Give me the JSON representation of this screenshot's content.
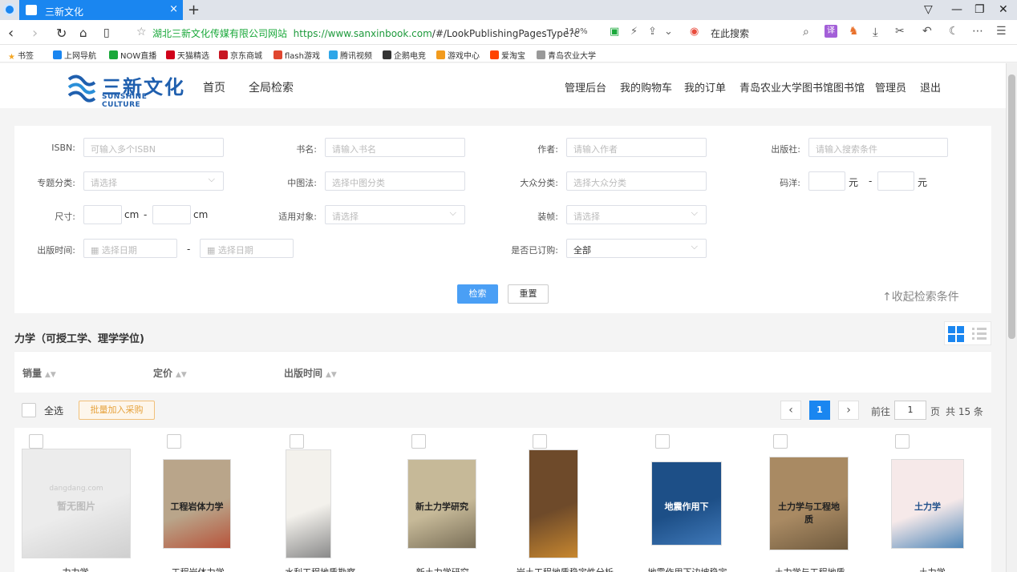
{
  "browser": {
    "tab_title": "三新文化",
    "tab_close": "×",
    "new_tab": "+",
    "site_name": "湖北三新文化传媒有限公司网站",
    "url_domain": "https://www.sanxinbook.com",
    "url_path": "/#/LookPublishingPagesType?c",
    "zoom": "110%",
    "search_label": "在此搜索",
    "bookmarks": [
      {
        "label": "书签",
        "color": "#f5a623"
      },
      {
        "label": "上网导航",
        "color": "#1a86f0"
      },
      {
        "label": "NOW直播",
        "color": "#1aa83a"
      },
      {
        "label": "天猫精选",
        "color": "#d0021b"
      },
      {
        "label": "京东商城",
        "color": "#c81623"
      },
      {
        "label": "flash游戏",
        "color": "#e0462f"
      },
      {
        "label": "腾讯视频",
        "color": "#2fa6e8"
      },
      {
        "label": "企鹅电竞",
        "color": "#333333"
      },
      {
        "label": "游戏中心",
        "color": "#f29b1d"
      },
      {
        "label": "爱淘宝",
        "color": "#ff4400"
      },
      {
        "label": "青岛农业大学",
        "color": "#999999"
      }
    ]
  },
  "header": {
    "logo_cn": "三新文化",
    "logo_en": "SUNSHINE CULTURE",
    "nav_home": "首页",
    "nav_search": "全局检索",
    "right_nav": [
      "管理后台",
      "我的购物车",
      "我的订单",
      "青岛农业大学图书馆图书馆",
      "管理员",
      "退出"
    ]
  },
  "search": {
    "isbn_label": "ISBN:",
    "isbn_placeholder": "可输入多个ISBN",
    "title_label": "书名:",
    "title_placeholder": "请输入书名",
    "author_label": "作者:",
    "author_placeholder": "请输入作者",
    "publisher_label": "出版社:",
    "publisher_placeholder": "请输入搜索条件",
    "topic_label": "专题分类:",
    "topic_placeholder": "请选择",
    "clc_label": "中图法:",
    "clc_placeholder": "选择中图分类",
    "popular_label": "大众分类:",
    "popular_placeholder": "选择大众分类",
    "price_label": "码洋:",
    "price_unit": "元",
    "dash": "-",
    "size_label": "尺寸:",
    "size_unit": "cm",
    "audience_label": "适用对象:",
    "audience_placeholder": "请选择",
    "binding_label": "装帧:",
    "binding_placeholder": "请选择",
    "date_label": "出版时间:",
    "date_placeholder": "选择日期",
    "ordered_label": "是否已订购:",
    "ordered_value": "全部",
    "search_button": "检索",
    "reset_button": "重置",
    "collapse_label": "↑收起检索条件"
  },
  "category_title": "力学（可授工学、理学学位)",
  "sort": {
    "sales": "销量",
    "price": "定价",
    "pub_date": "出版时间"
  },
  "actions": {
    "select_all": "全选",
    "batch_add": "批量加入采购",
    "prev": "‹",
    "next": "›",
    "current_page": "1",
    "goto_label": "前往",
    "goto_value": "1",
    "page_unit": "页",
    "total": "共 15 条"
  },
  "books": [
    {
      "title": "力力学",
      "cover_text": "暂无图片",
      "cover_sub": "dangdang.com",
      "colors": [
        "#ececec",
        "#cfcfcf"
      ]
    },
    {
      "title": "工程岩体力学",
      "cover_text": "工程岩体力学",
      "colors": [
        "#b9a58a",
        "#b8533a"
      ]
    },
    {
      "title": "水利工程地质勘察",
      "cover_text": "",
      "colors": [
        "#f3f1ec",
        "#8a8a8a"
      ]
    },
    {
      "title": "新土力学研究",
      "cover_text": "新土力学研究",
      "colors": [
        "#c6b998",
        "#7a6f58"
      ]
    },
    {
      "title": "岩土工程地质稳定性分析",
      "cover_text": "",
      "colors": [
        "#6e4a2a",
        "#c7872f"
      ]
    },
    {
      "title": "地震作用下边坡稳定",
      "cover_text": "地震作用下",
      "colors": [
        "#1d4f87",
        "#3f78b8"
      ]
    },
    {
      "title": "土力学与工程地质",
      "cover_text": "土力学与工程地质",
      "colors": [
        "#a98a63",
        "#6f5a3e"
      ]
    },
    {
      "title": "土力学",
      "cover_text": "土力学",
      "colors": [
        "#f6e9e9",
        "#4f86b8"
      ]
    }
  ],
  "colors": {
    "accent": "#1a86f0",
    "search_button": "#4a9ff5",
    "batch_text": "#e6a23c",
    "url_green": "#1aa83a"
  }
}
